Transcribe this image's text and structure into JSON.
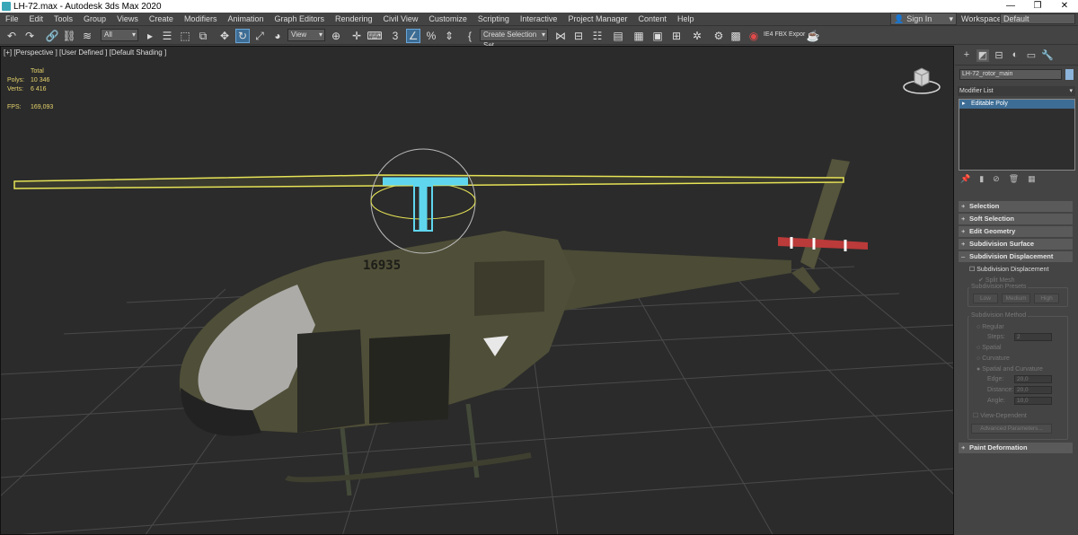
{
  "window": {
    "title": "LH-72.max - Autodesk 3ds Max 2020",
    "minimize": "—",
    "restore": "❐",
    "close": "✕"
  },
  "menu": {
    "items": [
      "File",
      "Edit",
      "Tools",
      "Group",
      "Views",
      "Create",
      "Modifiers",
      "Animation",
      "Graph Editors",
      "Rendering",
      "Civil View",
      "Customize",
      "Scripting",
      "Interactive",
      "Project Manager",
      "Content",
      "Help"
    ],
    "sign_in": "Sign In",
    "workspaces_label": "Workspaces:",
    "workspaces_value": "Default"
  },
  "toolbar": {
    "filter_value": "All",
    "refcoord_value": "View",
    "selection_set_value": "Create Selection Set",
    "fbx_export_label": "IE4 FBX Expor"
  },
  "viewport": {
    "label": "[+] [Perspective ] [User Defined ] [Default Shading ]",
    "stats_header": "Total",
    "polys_label": "Polys:",
    "polys_value": "10 346",
    "verts_label": "Verts:",
    "verts_value": "6 416",
    "fps_label": "FPS:",
    "fps_value": "169,093",
    "tail_number": "16935"
  },
  "command_panel": {
    "object_name": "LH-72_rotor_main",
    "object_color": "#8cb3d9",
    "modifier_list_label": "Modifier List",
    "modifier_stack": [
      "Editable Poly"
    ],
    "rollouts": {
      "selection": "Selection",
      "soft_selection": "Soft Selection",
      "edit_geometry": "Edit Geometry",
      "subdivision_surface": "Subdivision Surface",
      "subdivision_displacement": "Subdivision Displacement",
      "paint_deformation": "Paint Deformation"
    },
    "subdiv": {
      "checkbox_label": "Subdivision Displacement",
      "split_mesh": "Split Mesh",
      "presets_label": "Subdivision Presets",
      "preset_low": "Low",
      "preset_medium": "Medium",
      "preset_high": "High",
      "method_label": "Subdivision Method",
      "regular": "Regular",
      "steps_label": "Steps:",
      "steps_value": "2",
      "spatial": "Spatial",
      "curvature": "Curvature",
      "spatial_curvature": "Spatial and Curvature",
      "edge_label": "Edge:",
      "edge_value": "20,0",
      "distance_label": "Distance:",
      "distance_value": "20,0",
      "angle_label": "Angle:",
      "angle_value": "10,0",
      "view_dependent": "View-Dependent",
      "advanced": "Advanced Parameters..."
    }
  }
}
